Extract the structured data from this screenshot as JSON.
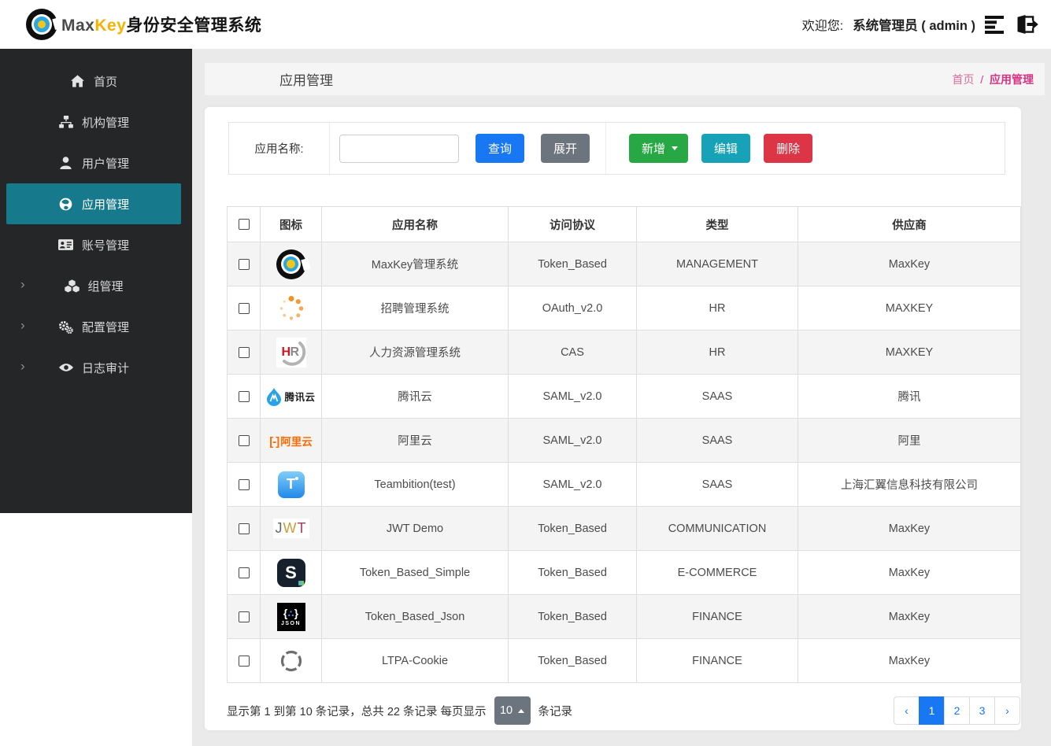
{
  "header": {
    "brand_max": "Max",
    "brand_key": "Key",
    "brand_suffix": "身份安全管理系统",
    "welcome_label": "欢迎您:",
    "username": "系统管理员 ( admin )",
    "icons": [
      "maxkey-logo-icon",
      "list-menu-icon",
      "logout-icon"
    ]
  },
  "sidebar": {
    "items": [
      {
        "id": "home",
        "label": "首页",
        "icon": "home-icon",
        "active": false,
        "expandable": false
      },
      {
        "id": "org",
        "label": "机构管理",
        "icon": "sitemap-icon",
        "active": false,
        "expandable": false
      },
      {
        "id": "user",
        "label": "用户管理",
        "icon": "user-icon",
        "active": false,
        "expandable": false
      },
      {
        "id": "app",
        "label": "应用管理",
        "icon": "globe-icon",
        "active": true,
        "expandable": false
      },
      {
        "id": "account",
        "label": "账号管理",
        "icon": "idcard-icon",
        "active": false,
        "expandable": false
      },
      {
        "id": "group",
        "label": "组管理",
        "icon": "cubes-icon",
        "active": false,
        "expandable": true
      },
      {
        "id": "config",
        "label": "配置管理",
        "icon": "gears-icon",
        "active": false,
        "expandable": true
      },
      {
        "id": "audit",
        "label": "日志审计",
        "icon": "eye-icon",
        "active": false,
        "expandable": true
      }
    ]
  },
  "page": {
    "title": "应用管理",
    "breadcrumb_root": "首页",
    "breadcrumb_sep": "/",
    "breadcrumb_current": "应用管理"
  },
  "toolbar": {
    "search_label": "应用名称:",
    "search_value": "",
    "query_label": "查询",
    "expand_label": "展开",
    "add_label": "新增",
    "edit_label": "编辑",
    "delete_label": "删除"
  },
  "table": {
    "columns": [
      "图标",
      "应用名称",
      "访问协议",
      "类型",
      "供应商"
    ],
    "rows": [
      {
        "icon": "maxkey-logo",
        "name": "MaxKey管理系统",
        "protocol": "Token_Based",
        "type": "MANAGEMENT",
        "vendor": "MaxKey"
      },
      {
        "icon": "spinner",
        "name": "招聘管理系统",
        "protocol": "OAuth_v2.0",
        "type": "HR",
        "vendor": "MAXKEY"
      },
      {
        "icon": "hr",
        "name": "人力资源管理系统",
        "protocol": "CAS",
        "type": "HR",
        "vendor": "MAXKEY"
      },
      {
        "icon": "tencent-cloud",
        "name": "腾讯云",
        "protocol": "SAML_v2.0",
        "type": "SAAS",
        "vendor": "腾讯"
      },
      {
        "icon": "aliyun",
        "name": "阿里云",
        "protocol": "SAML_v2.0",
        "type": "SAAS",
        "vendor": "阿里"
      },
      {
        "icon": "teambition",
        "name": "Teambition(test)",
        "protocol": "SAML_v2.0",
        "type": "SAAS",
        "vendor": "上海汇翼信息科技有限公司"
      },
      {
        "icon": "jwt",
        "name": "JWT Demo",
        "protocol": "Token_Based",
        "type": "COMMUNICATION",
        "vendor": "MaxKey"
      },
      {
        "icon": "s-letter",
        "name": "Token_Based_Simple",
        "protocol": "Token_Based",
        "type": "E-COMMERCE",
        "vendor": "MaxKey"
      },
      {
        "icon": "json",
        "name": "Token_Based_Json",
        "protocol": "Token_Based",
        "type": "FINANCE",
        "vendor": "MaxKey"
      },
      {
        "icon": "ltpa-target",
        "name": "LTPA-Cookie",
        "protocol": "Token_Based",
        "type": "FINANCE",
        "vendor": "MaxKey"
      }
    ]
  },
  "pagination": {
    "summary_prefix": "显示第 1 到第 10 条记录，总共 22 条记录 每页显示",
    "page_size": "10",
    "summary_suffix": "条记录",
    "prev_label": "‹",
    "next_label": "›",
    "pages": [
      "1",
      "2",
      "3"
    ],
    "active_page": "1"
  },
  "colors": {
    "primary_blue": "#1877f2",
    "success_green": "#28a745",
    "info_teal": "#17a2b8",
    "danger_red": "#dc3545",
    "secondary_gray": "#6c757d",
    "sidebar_bg": "#252628",
    "active_menu_teal": "#16798c",
    "breadcrumb_accent": "#d63384",
    "brand_yellow": "#f8b300",
    "stripe_gray": "#f4f4f4"
  }
}
